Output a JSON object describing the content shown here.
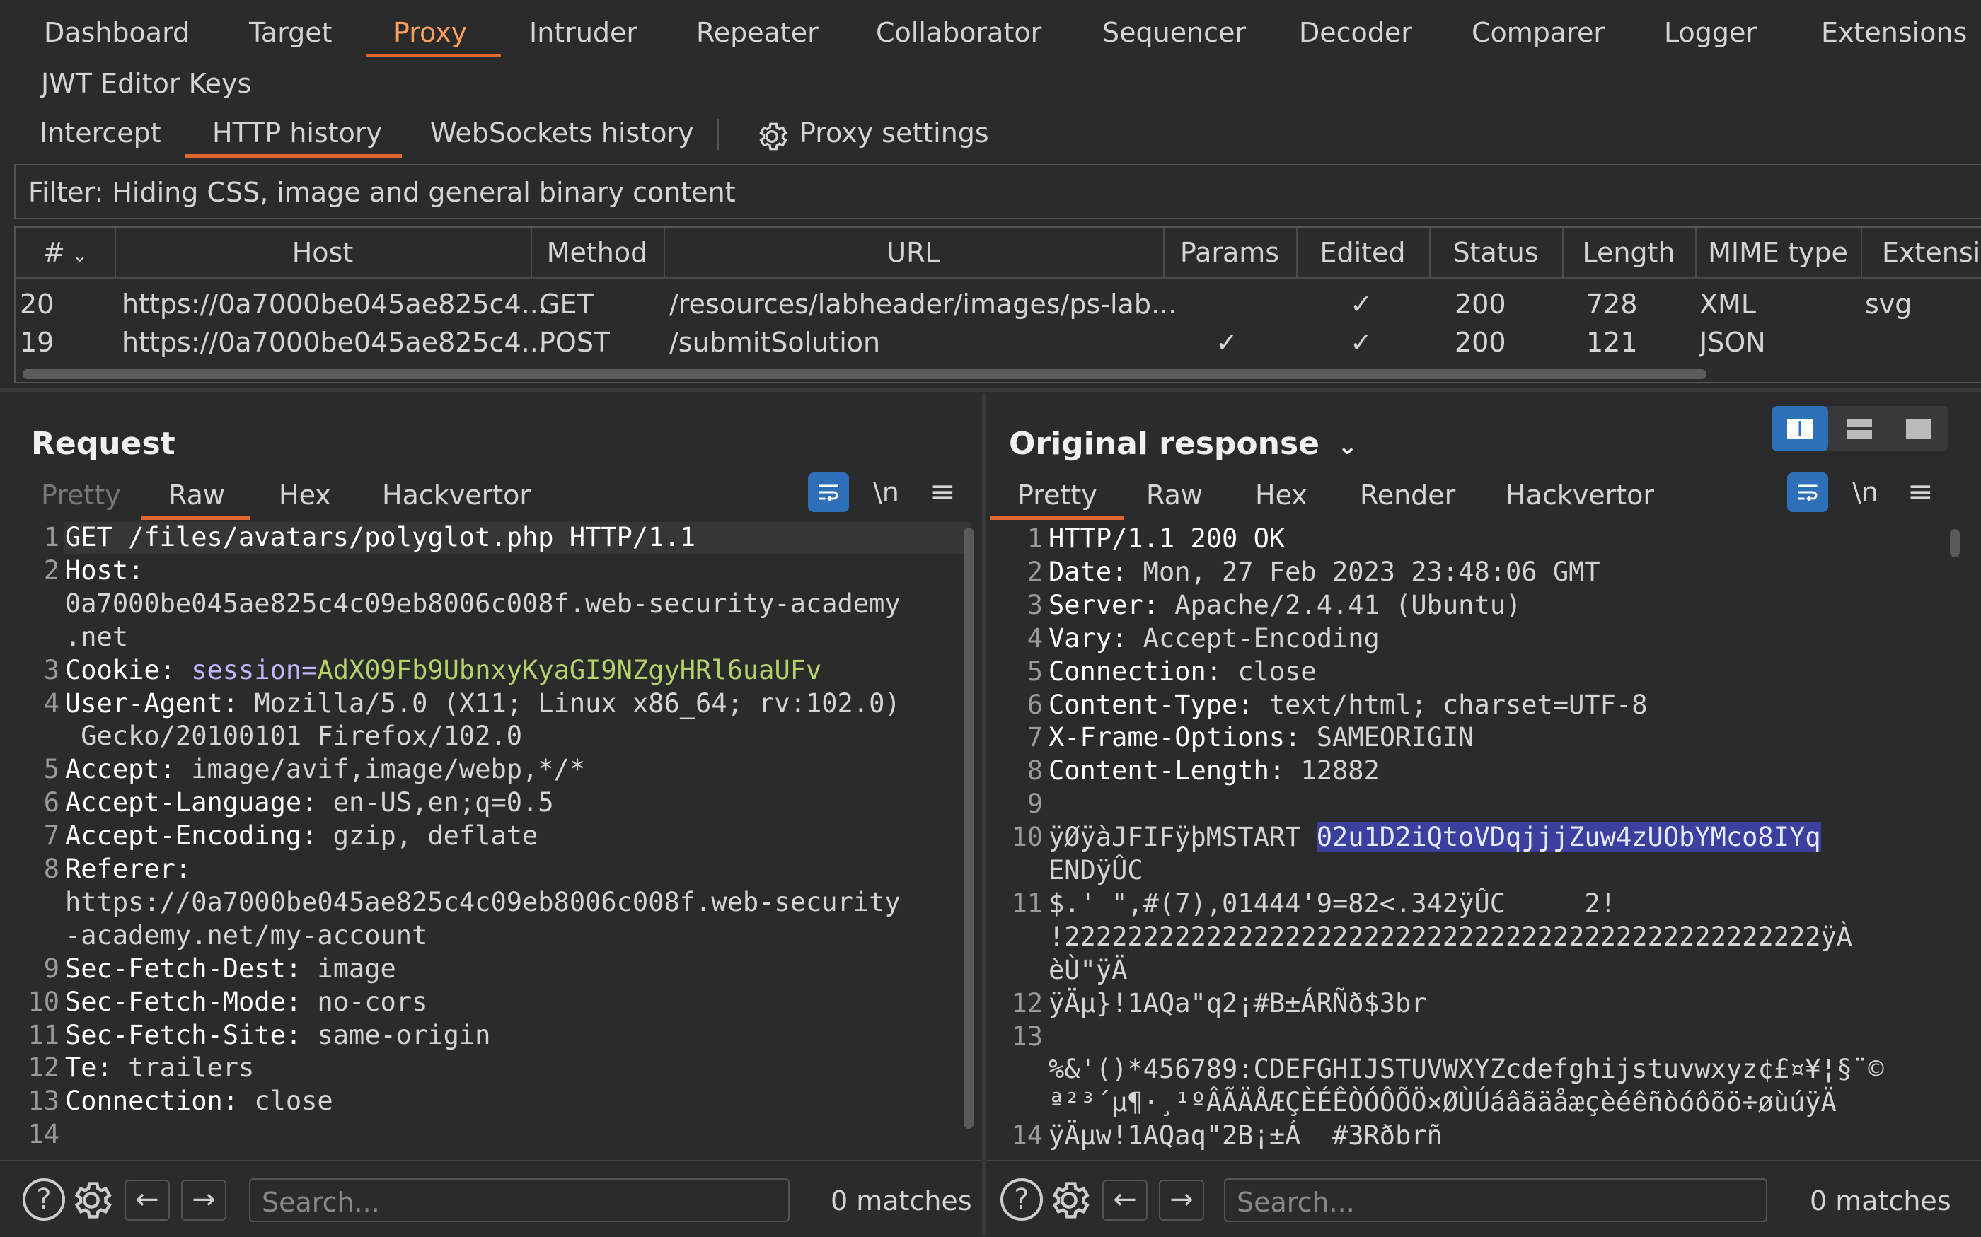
{
  "app": {
    "top_tabs": [
      "Dashboard",
      "Target",
      "Proxy",
      "Intruder",
      "Repeater",
      "Collaborator",
      "Sequencer",
      "Decoder",
      "Comparer",
      "Logger",
      "Extensions"
    ],
    "second_row_tab": "JWT Editor Keys",
    "proxy_tabs": [
      "Intercept",
      "HTTP history",
      "WebSockets history"
    ],
    "proxy_settings": "Proxy settings"
  },
  "filter_text": "Filter: Hiding CSS, image and general binary content",
  "history": {
    "columns": [
      "#",
      "Host",
      "Method",
      "URL",
      "Params",
      "Edited",
      "Status",
      "Length",
      "MIME type",
      "Extensic"
    ],
    "rows": [
      {
        "num": "20",
        "host": "https://0a7000be045ae825c4...",
        "method": "GET",
        "url": "/resources/labheader/images/ps-lab...",
        "params": "",
        "edited": "✓",
        "status": "200",
        "length": "728",
        "mime": "XML",
        "ext": "svg"
      },
      {
        "num": "19",
        "host": "https://0a7000be045ae825c4...",
        "method": "POST",
        "url": "/submitSolution",
        "params": "✓",
        "edited": "✓",
        "status": "200",
        "length": "121",
        "mime": "JSON",
        "ext": ""
      }
    ]
  },
  "request": {
    "title": "Request",
    "tabs": [
      "Pretty",
      "Raw",
      "Hex",
      "Hackvertor"
    ],
    "newline_label": "\\n",
    "search_placeholder": "Search...",
    "matches": "0 matches",
    "lines": [
      {
        "n": "1",
        "key": "GET /files/avatars/polyglot.php HTTP/1.1",
        "val": ""
      },
      {
        "n": "2",
        "key": "Host:",
        "val": ""
      },
      {
        "n": "",
        "key": "",
        "val": "0a7000be045ae825c4c09eb8006c008f.web-security-academy"
      },
      {
        "n": "",
        "key": "",
        "val": ".net"
      },
      {
        "n": "3",
        "key": "Cookie: ",
        "val": "session=",
        "cookie": "AdX09Fb9UbnxyKyaGI9NZgyHRl6uaUFv"
      },
      {
        "n": "4",
        "key": "User-Agent:",
        "val": " Mozilla/5.0 (X11; Linux x86_64; rv:102.0)"
      },
      {
        "n": "",
        "key": "",
        "val": " Gecko/20100101 Firefox/102.0"
      },
      {
        "n": "5",
        "key": "Accept:",
        "val": " image/avif,image/webp,*/*"
      },
      {
        "n": "6",
        "key": "Accept-Language:",
        "val": " en-US,en;q=0.5"
      },
      {
        "n": "7",
        "key": "Accept-Encoding:",
        "val": " gzip, deflate"
      },
      {
        "n": "8",
        "key": "Referer:",
        "val": ""
      },
      {
        "n": "",
        "key": "",
        "val": "https://0a7000be045ae825c4c09eb8006c008f.web-security"
      },
      {
        "n": "",
        "key": "",
        "val": "-academy.net/my-account"
      },
      {
        "n": "9",
        "key": "Sec-Fetch-Dest:",
        "val": " image"
      },
      {
        "n": "10",
        "key": "Sec-Fetch-Mode:",
        "val": " no-cors"
      },
      {
        "n": "11",
        "key": "Sec-Fetch-Site:",
        "val": " same-origin"
      },
      {
        "n": "12",
        "key": "Te:",
        "val": " trailers"
      },
      {
        "n": "13",
        "key": "Connection:",
        "val": " close"
      },
      {
        "n": "14",
        "key": "",
        "val": ""
      }
    ]
  },
  "response": {
    "title": "Original response",
    "tabs": [
      "Pretty",
      "Raw",
      "Hex",
      "Render",
      "Hackvertor"
    ],
    "newline_label": "\\n",
    "search_placeholder": "Search...",
    "matches": "0 matches",
    "lines": [
      {
        "n": "1",
        "key": "HTTP/1.1 200 OK",
        "val": ""
      },
      {
        "n": "2",
        "key": "Date:",
        "val": " Mon, 27 Feb 2023 23:48:06 GMT"
      },
      {
        "n": "3",
        "key": "Server:",
        "val": " Apache/2.4.41 (Ubuntu)"
      },
      {
        "n": "4",
        "key": "Vary:",
        "val": " Accept-Encoding"
      },
      {
        "n": "5",
        "key": "Connection:",
        "val": " close"
      },
      {
        "n": "6",
        "key": "Content-Type:",
        "val": " text/html; charset=UTF-8"
      },
      {
        "n": "7",
        "key": "X-Frame-Options:",
        "val": " SAMEORIGIN"
      },
      {
        "n": "8",
        "key": "Content-Length:",
        "val": " 12882"
      },
      {
        "n": "9",
        "key": "",
        "val": ""
      },
      {
        "n": "10",
        "key": "",
        "val": "ÿØÿàJFIFÿþMSTART ",
        "hl": "02u1D2iQtoVDqjjjZuw4zUObYMco8IYq"
      },
      {
        "n": "",
        "key": "",
        "val": "ENDÿÛC"
      },
      {
        "n": "11",
        "key": "",
        "val": "$.' \",#(7),01444'9=82<.342ÿÛC     2!"
      },
      {
        "n": "",
        "key": "",
        "val": "!222222222222222222222222222222222222222222222222ÿÀ"
      },
      {
        "n": "",
        "key": "",
        "val": "èÙ\"ÿÄ"
      },
      {
        "n": "12",
        "key": "",
        "val": "ÿÄµ}!1AQa\"q2¡#B±ÁRÑð$3br"
      },
      {
        "n": "13",
        "key": "",
        "val": ""
      },
      {
        "n": "",
        "key": "",
        "val": "%&'()*456789:CDEFGHIJSTUVWXYZcdefghijstuvwxyz¢£¤¥¦§¨©"
      },
      {
        "n": "",
        "key": "",
        "val": "ª²³´µ¶·¸¹ºÂÃÄÅÆÇÈÉÊÒÓÔÕÖ×ØÙÚáâãäåæçèéêñòóôõö÷øùúÿÄ"
      },
      {
        "n": "14",
        "key": "",
        "val": "ÿÄµw!1AQaq\"2B¡±Á  #3Rðbrñ"
      }
    ]
  }
}
